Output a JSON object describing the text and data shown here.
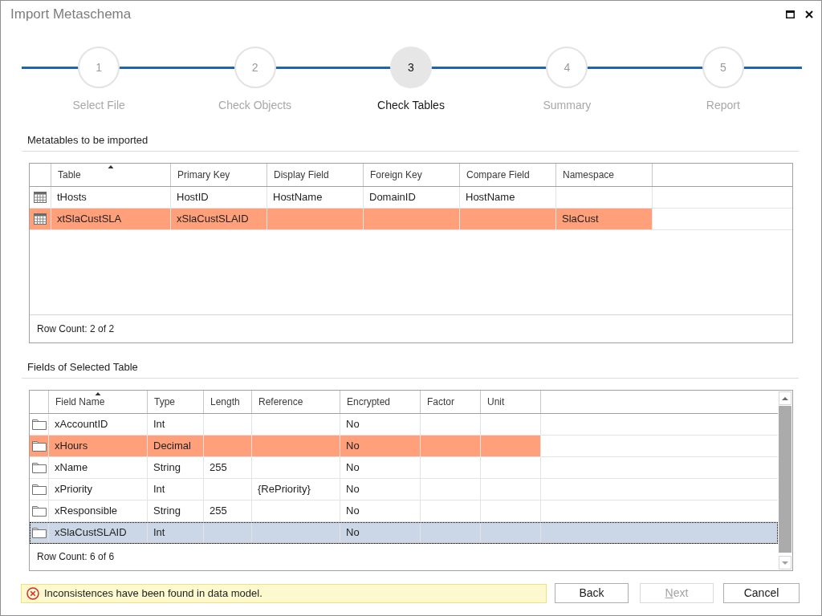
{
  "window": {
    "title": "Import Metaschema"
  },
  "steps": [
    {
      "number": "1",
      "label": "Select File",
      "selected": false
    },
    {
      "number": "2",
      "label": "Check Objects",
      "selected": false
    },
    {
      "number": "3",
      "label": "Check Tables",
      "selected": true
    },
    {
      "number": "4",
      "label": "Summary",
      "selected": false
    },
    {
      "number": "5",
      "label": "Report",
      "selected": false
    }
  ],
  "metatables": {
    "heading": "Metatables to be imported",
    "columns": [
      {
        "label": "Table",
        "sorted": true
      },
      {
        "label": "Primary Key",
        "sorted": false
      },
      {
        "label": "Display Field",
        "sorted": false
      },
      {
        "label": "Foreign Key",
        "sorted": false
      },
      {
        "label": "Compare Field",
        "sorted": false
      },
      {
        "label": "Namespace",
        "sorted": false
      }
    ],
    "rows": [
      {
        "cells": [
          "tHosts",
          "HostID",
          "HostName",
          "DomainID",
          "HostName",
          null
        ],
        "error": false
      },
      {
        "cells": [
          "xtSlaCustSLA",
          "xSlaCustSLAID",
          null,
          null,
          null,
          "SlaCust"
        ],
        "error": true
      }
    ],
    "row_count": "Row Count: 2 of 2"
  },
  "fields": {
    "heading": "Fields of Selected Table",
    "columns": [
      {
        "label": "Field Name",
        "sorted": true
      },
      {
        "label": "Type",
        "sorted": false
      },
      {
        "label": "Length",
        "sorted": false
      },
      {
        "label": "Reference",
        "sorted": false
      },
      {
        "label": "Encrypted",
        "sorted": false
      },
      {
        "label": "Factor",
        "sorted": false
      },
      {
        "label": "Unit",
        "sorted": false
      }
    ],
    "rows": [
      {
        "cells": [
          "xAccountID",
          "Int",
          null,
          null,
          "No",
          null,
          null
        ],
        "error": false,
        "selected": false
      },
      {
        "cells": [
          "xHours",
          "Decimal",
          null,
          null,
          "No",
          null,
          null
        ],
        "error": true,
        "selected": false
      },
      {
        "cells": [
          "xName",
          "String",
          "255",
          null,
          "No",
          null,
          null
        ],
        "error": false,
        "selected": false
      },
      {
        "cells": [
          "xPriority",
          "Int",
          null,
          "{RePriority}",
          "No",
          null,
          null
        ],
        "error": false,
        "selected": false
      },
      {
        "cells": [
          "xResponsible",
          "String",
          "255",
          null,
          "No",
          null,
          null
        ],
        "error": false,
        "selected": false
      },
      {
        "cells": [
          "xSlaCustSLAID",
          "Int",
          null,
          null,
          "No",
          null,
          null
        ],
        "error": false,
        "selected": true
      }
    ],
    "row_count": "Row Count: 6 of 6"
  },
  "status": {
    "message": "Inconsistences have been found in data model."
  },
  "buttons": [
    {
      "label": "Back",
      "disabled": false,
      "mnemonic": false
    },
    {
      "label": "Next",
      "disabled": true,
      "mnemonic": true
    },
    {
      "label": "Cancel",
      "disabled": false,
      "mnemonic": false
    }
  ]
}
